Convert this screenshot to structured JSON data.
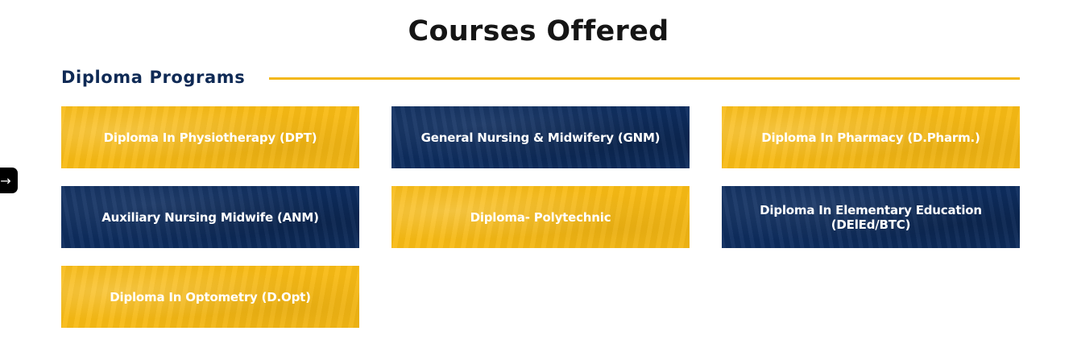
{
  "page": {
    "title": "Courses Offered"
  },
  "section": {
    "label": "Diploma Programs",
    "accent_color": "#f3b718",
    "heading_color": "#0f2a55"
  },
  "side_tab": {
    "glyph": "→",
    "icon": "arrow-right-icon"
  },
  "colors": {
    "gold": "#f8bb15",
    "navy": "#0e2d5f"
  },
  "courses": [
    {
      "label": "Diploma In Physiotherapy (DPT)",
      "theme": "gold"
    },
    {
      "label": "General Nursing & Midwifery (GNM)",
      "theme": "navy"
    },
    {
      "label": "Diploma In Pharmacy (D.Pharm.)",
      "theme": "gold"
    },
    {
      "label": "Auxiliary Nursing Midwife (ANM)",
      "theme": "navy"
    },
    {
      "label": "Diploma- Polytechnic",
      "theme": "gold"
    },
    {
      "label": "Diploma In Elementary Education (DElEd/BTC)",
      "theme": "navy"
    },
    {
      "label": "Diploma In Optometry (D.Opt)",
      "theme": "gold"
    }
  ]
}
